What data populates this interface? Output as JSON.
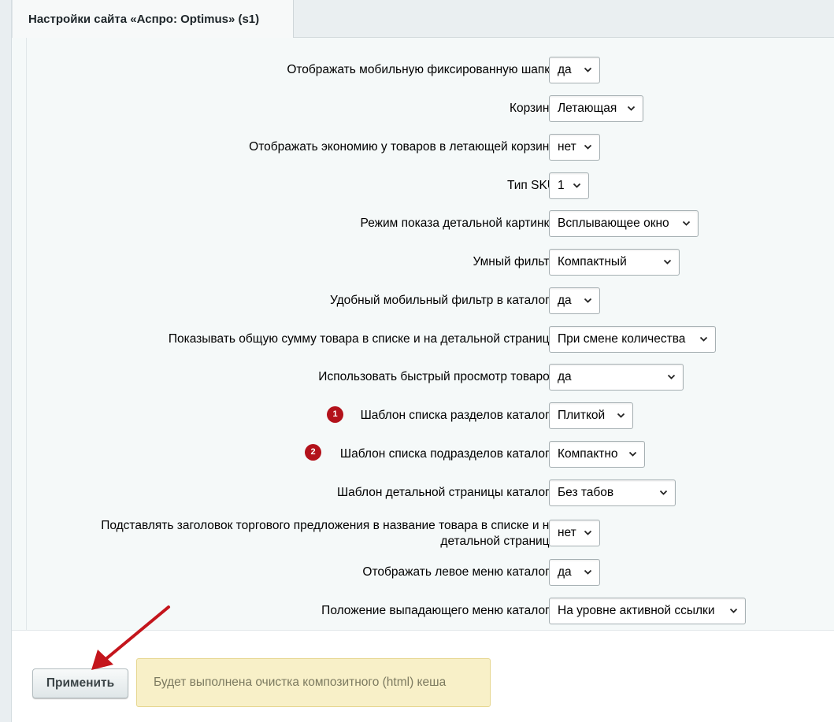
{
  "tab": {
    "title": "Настройки сайта «Аспро: Optimus» (s1)"
  },
  "settings": [
    {
      "label": "Отображать мобильную фиксированную шапку",
      "value": "да"
    },
    {
      "label": "Корзина",
      "value": "Летающая"
    },
    {
      "label": "Отображать экономию у товаров в летающей корзине",
      "value": "нет"
    },
    {
      "label": "Тип SKU",
      "value": "1"
    },
    {
      "label": "Режим показа детальной картинки",
      "value": "Всплывающее окно"
    },
    {
      "label": "Умный фильтр",
      "value": "Компактный"
    },
    {
      "label": "Удобный мобильный фильтр в каталоге",
      "value": "да"
    },
    {
      "label": "Показывать общую сумму товара в списке и на детальной странице",
      "value": "При смене количества"
    },
    {
      "label": "Использовать быстрый просмотр товаров",
      "value": "да"
    },
    {
      "label": "Шаблон списка разделов каталога",
      "value": "Плиткой",
      "badge": "1"
    },
    {
      "label": "Шаблон списка подразделов каталога",
      "value": "Компактно",
      "badge": "2"
    },
    {
      "label": "Шаблон детальной страницы каталога",
      "value": "Без табов"
    },
    {
      "label": "Подставлять заголовок торгового предложения в название товара в списке и на детальной странице",
      "value": "нет"
    },
    {
      "label": "Отображать левое меню каталога",
      "value": "да"
    },
    {
      "label": "Положение выпадающего меню каталога",
      "value": "На уровне активной ссылки"
    }
  ],
  "footer": {
    "apply_label": "Применить",
    "notice": "Будет выполнена очистка композитного (html) кеша"
  },
  "colors": {
    "badge": "#b3121b",
    "arrow": "#c4151c",
    "notice_bg": "#f8f0c8"
  }
}
